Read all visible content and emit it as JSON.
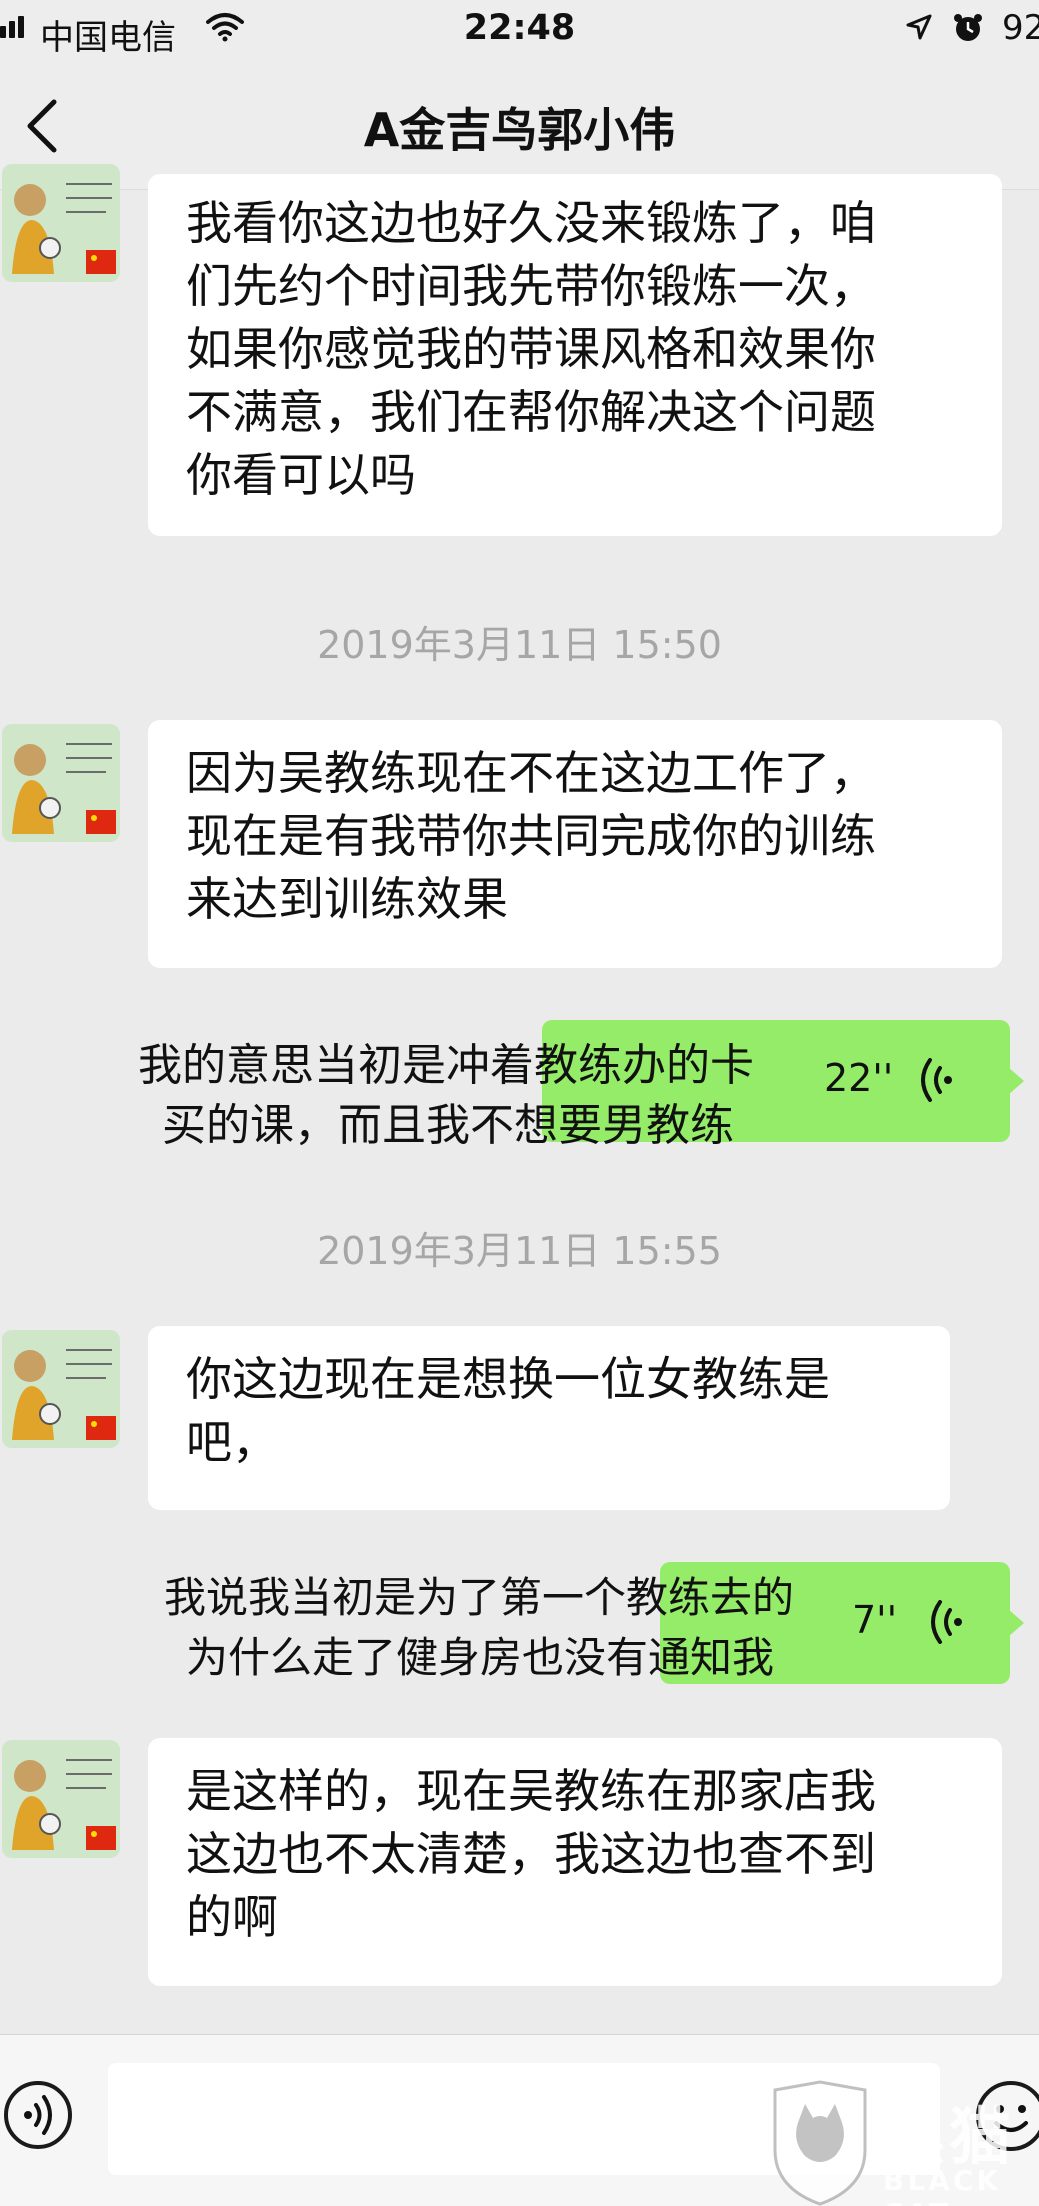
{
  "status_bar": {
    "carrier": "中国电信",
    "time": "22:48",
    "battery": "92"
  },
  "nav": {
    "title": "A金吉鸟郭小伟"
  },
  "messages": [
    {
      "type": "received",
      "lines": [
        "我看你这边也好久没来锻炼了，咱",
        "们先约个时间我先带你锻炼一次，",
        "如果你感觉我的带课风格和效果你",
        "不满意，我们在帮你解决这个问题",
        "你看可以吗"
      ]
    },
    {
      "type": "timestamp",
      "text": "2019年3月11日 15:50"
    },
    {
      "type": "received",
      "lines": [
        "因为吴教练现在不在这边工作了，",
        "现在是有我带你共同完成你的训练",
        "来达到训练效果"
      ]
    },
    {
      "type": "voice_sent",
      "duration": "22''",
      "overlay_lines": [
        "我的意思当初是冲着教练办的卡",
        "买的课，而且我不想要男教练"
      ]
    },
    {
      "type": "timestamp",
      "text": "2019年3月11日 15:55"
    },
    {
      "type": "received",
      "lines": [
        "你这边现在是想换一位女教练是",
        "吧，"
      ]
    },
    {
      "type": "voice_sent",
      "duration": "7''",
      "overlay_lines": [
        "我说我当初是为了第一个教练去的",
        "为什么走了健身房也没有通知我"
      ]
    },
    {
      "type": "received",
      "lines": [
        "是这样的，现在吴教练在那家店我",
        "这边也不太清楚，我这边也查不到",
        "的啊"
      ]
    }
  ],
  "input": {
    "placeholder": ""
  },
  "watermark": {
    "text": "黑猫",
    "sub": "BLACK CAT"
  },
  "colors": {
    "background": "#ebebeb",
    "received_bubble": "#ffffff",
    "sent_voice_bubble": "#95ec69",
    "timestamp": "#a6a6a6"
  }
}
